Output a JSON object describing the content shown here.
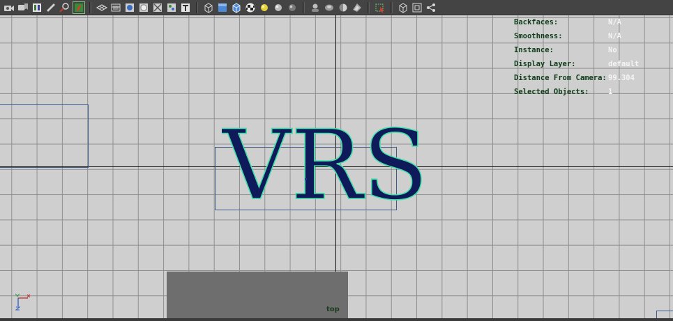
{
  "viewport": {
    "view_name": "top",
    "hud": [
      {
        "label": "Backfaces:",
        "value": "N/A"
      },
      {
        "label": "Smoothness:",
        "value": "N/A"
      },
      {
        "label": "Instance:",
        "value": "No"
      },
      {
        "label": "Display Layer:",
        "value": "default"
      },
      {
        "label": "Distance From Camera:",
        "value": "99.304"
      },
      {
        "label": "Selected Objects:",
        "value": "1"
      }
    ],
    "object_text": "VRS"
  },
  "colors": {
    "grid_background": "#cfcfcf",
    "grid_line": "#8f8f8f",
    "text_fill": "#0e1a5a",
    "selection_outline": "#3fe0a8",
    "hud_label": "#0f3d18",
    "hud_value": "#f4f4f4"
  },
  "toolbar": {
    "icons": [
      "camera-attributes-icon",
      "bookmark-icon",
      "image-plane-icon",
      "grease-pencil-icon",
      "2d-pan-zoom-icon",
      "film-gate-icon",
      "grid-toggle-icon",
      "resolution-gate-icon",
      "field-chart-icon",
      "safe-action-icon",
      "safe-title-icon",
      "toggle-text-icon",
      "wireframe-icon",
      "smooth-shade-icon",
      "wireframe-on-shaded-icon",
      "textured-icon",
      "use-lights-icon",
      "shadows-icon",
      "ambient-occlusion-icon",
      "isolate-select-icon",
      "xray-icon",
      "xray-joints-icon",
      "xray-components-icon",
      "select-camera-icon",
      "single-view-icon",
      "four-view-icon",
      "outliner-graph-icon"
    ]
  }
}
